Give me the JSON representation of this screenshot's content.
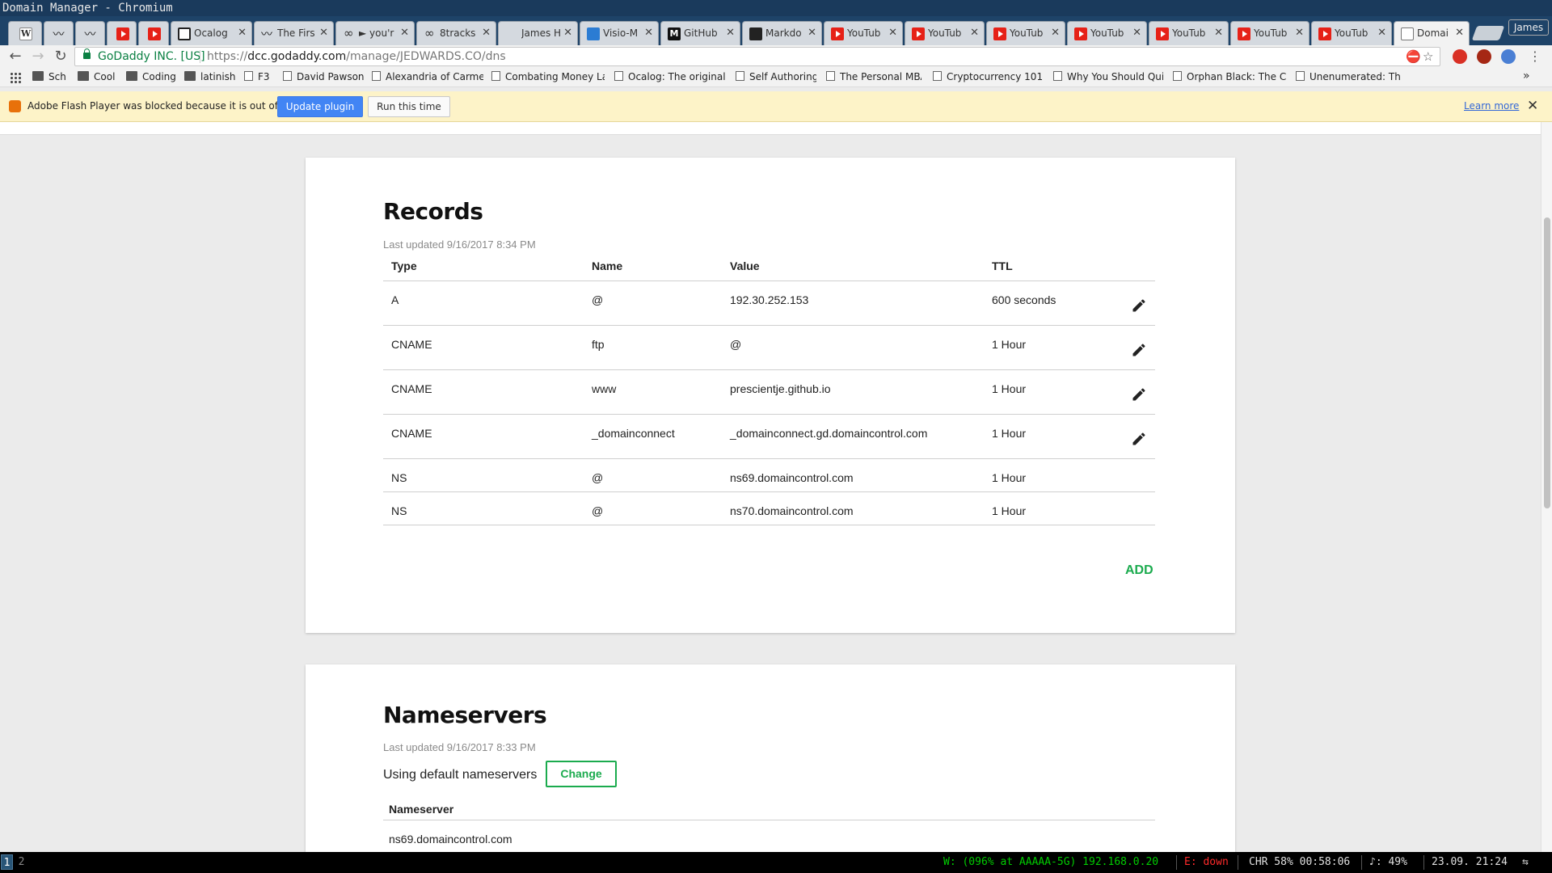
{
  "window": {
    "title": "Domain Manager - Chromium"
  },
  "tabs": [
    {
      "label": "",
      "icon": "wikipedia-icon"
    },
    {
      "label": "",
      "icon": "mustache-icon"
    },
    {
      "label": "",
      "icon": "mustache-icon"
    },
    {
      "label": "",
      "icon": "youtube-icon"
    },
    {
      "label": "",
      "icon": "youtube-icon"
    },
    {
      "label": "Ocalog",
      "icon": "ocalog-icon"
    },
    {
      "label": "The Firs",
      "icon": "mustache-icon"
    },
    {
      "label": "► you'r",
      "icon": "link-icon"
    },
    {
      "label": "8tracks",
      "icon": "link-icon"
    },
    {
      "label": "James H",
      "icon": "blank-icon"
    },
    {
      "label": "Visio-M",
      "icon": "visio-icon"
    },
    {
      "label": "GitHub",
      "icon": "medium-icon"
    },
    {
      "label": "Markdo",
      "icon": "github-icon"
    },
    {
      "label": "YouTub",
      "icon": "youtube-icon"
    },
    {
      "label": "YouTub",
      "icon": "youtube-icon"
    },
    {
      "label": "YouTub",
      "icon": "youtube-icon"
    },
    {
      "label": "YouTub",
      "icon": "youtube-icon"
    },
    {
      "label": "YouTub",
      "icon": "youtube-icon"
    },
    {
      "label": "YouTub",
      "icon": "youtube-icon"
    },
    {
      "label": "YouTub",
      "icon": "youtube-icon"
    },
    {
      "label": "Domai",
      "icon": "document-icon",
      "active": true
    }
  ],
  "profile": "James",
  "omnibox": {
    "secure_label": "GoDaddy INC. [US]",
    "url_prefix": "https://",
    "url_host": "dcc.godaddy.com",
    "url_path": "/manage/JEDWARDS.CO/dns"
  },
  "bookmarks": [
    {
      "label": "Sch",
      "icon": "folder-icon"
    },
    {
      "label": "Cool",
      "icon": "folder-icon"
    },
    {
      "label": "Coding",
      "icon": "folder-icon"
    },
    {
      "label": "latinish",
      "icon": "folder-icon"
    },
    {
      "label": "F3",
      "icon": "page-icon"
    },
    {
      "label": "David Pawson",
      "icon": "page-icon"
    },
    {
      "label": "Alexandria of Carmel",
      "icon": "page-icon"
    },
    {
      "label": "Combating Money La",
      "icon": "page-icon"
    },
    {
      "label": "Ocalog: The original c",
      "icon": "ocalog-icon"
    },
    {
      "label": "Self Authoring",
      "icon": "quill-icon"
    },
    {
      "label": "The Personal MBA",
      "icon": "page-icon"
    },
    {
      "label": "Cryptocurrency 101",
      "icon": "page-icon"
    },
    {
      "label": "Why You Should Quit",
      "icon": "page-icon"
    },
    {
      "label": "Orphan Black: The Cl",
      "icon": "page-icon"
    },
    {
      "label": "Unenumerated: The c",
      "icon": "blogger-icon"
    }
  ],
  "infobar": {
    "message": "Adobe Flash Player was blocked because it is out of date.",
    "update_label": "Update plugin",
    "run_label": "Run this time",
    "learn_more": "Learn more"
  },
  "records": {
    "title": "Records",
    "updated": "Last updated 9/16/2017 8:34 PM",
    "headers": {
      "type": "Type",
      "name": "Name",
      "value": "Value",
      "ttl": "TTL"
    },
    "rows": [
      {
        "type": "A",
        "name": "@",
        "value": "192.30.252.153",
        "ttl": "600 seconds",
        "editable": true
      },
      {
        "type": "CNAME",
        "name": "ftp",
        "value": "@",
        "ttl": "1 Hour",
        "editable": true
      },
      {
        "type": "CNAME",
        "name": "www",
        "value": "prescientje.github.io",
        "ttl": "1 Hour",
        "editable": true
      },
      {
        "type": "CNAME",
        "name": "_domainconnect",
        "value": "_domainconnect.gd.domaincontrol.com",
        "ttl": "1 Hour",
        "editable": true
      },
      {
        "type": "NS",
        "name": "@",
        "value": "ns69.domaincontrol.com",
        "ttl": "1 Hour",
        "editable": false
      },
      {
        "type": "NS",
        "name": "@",
        "value": "ns70.domaincontrol.com",
        "ttl": "1 Hour",
        "editable": false
      }
    ],
    "add_label": "ADD"
  },
  "nameservers": {
    "title": "Nameservers",
    "updated": "Last updated 9/16/2017 8:33 PM",
    "using": "Using default nameservers",
    "change_label": "Change",
    "header": "Nameserver",
    "first": "ns69.domaincontrol.com"
  },
  "statusbar": {
    "workspaces": [
      "1",
      "2"
    ],
    "wifi": "W: (096% at AAAAA-5G) 192.168.0.20",
    "ethernet": "E: down",
    "battery": "CHR 58% 00:58:06",
    "volume": "♪: 49%",
    "clock": "23.09. 21:24"
  },
  "colors": {
    "accent_green": "#1bab4e",
    "update_blue": "#4285f4",
    "infobar": "#fdf3c8"
  }
}
